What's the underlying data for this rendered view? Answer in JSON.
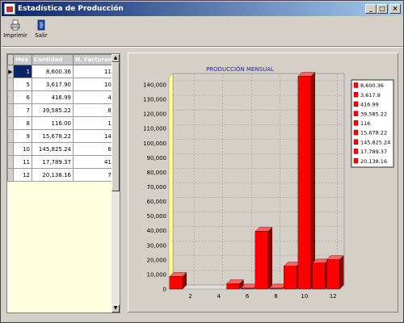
{
  "window": {
    "title": "Estadística de Producción"
  },
  "toolbar": {
    "print_label": "Imprimir",
    "exit_label": "Salir"
  },
  "table": {
    "columns": [
      "Mes",
      "Cantidad",
      "N. Facturas"
    ],
    "rows": [
      {
        "mes": "1",
        "cantidad": "8,600.36",
        "facturas": "11"
      },
      {
        "mes": "5",
        "cantidad": "3,617.90",
        "facturas": "10"
      },
      {
        "mes": "6",
        "cantidad": "416.99",
        "facturas": "4"
      },
      {
        "mes": "7",
        "cantidad": "39,585.22",
        "facturas": "8"
      },
      {
        "mes": "8",
        "cantidad": "116.00",
        "facturas": "1"
      },
      {
        "mes": "9",
        "cantidad": "15,678.22",
        "facturas": "14"
      },
      {
        "mes": "10",
        "cantidad": "145,825.24",
        "facturas": "6"
      },
      {
        "mes": "11",
        "cantidad": "17,789.37",
        "facturas": "41"
      },
      {
        "mes": "12",
        "cantidad": "20,138.16",
        "facturas": "7"
      }
    ]
  },
  "chart_data": {
    "type": "bar",
    "title": "PRODUCCIÓN MENSUAL",
    "x": [
      1,
      5,
      6,
      7,
      8,
      9,
      10,
      11,
      12
    ],
    "values": [
      8600.36,
      3617.9,
      416.99,
      39585.22,
      116,
      15678.22,
      145825.24,
      17789.37,
      20138.16
    ],
    "xticks": [
      "2",
      "4",
      "6",
      "8",
      "10",
      "12"
    ],
    "xlim": [
      0.5,
      12.5
    ],
    "yticks": [
      "0",
      "10,000",
      "20,000",
      "30,000",
      "40,000",
      "50,000",
      "60,000",
      "70,000",
      "80,000",
      "90,000",
      "100,000",
      "110,000",
      "120,000",
      "130,000",
      "140,000"
    ],
    "ylim": [
      0,
      145000
    ],
    "legend": [
      "8,600.36",
      "3,617.9",
      "416.99",
      "39,585.22",
      "116",
      "15,678.22",
      "145,825.24",
      "17,789.37",
      "20,138.16"
    ],
    "legend_position": "right",
    "grid": true,
    "bar_color": "#ff0000"
  }
}
